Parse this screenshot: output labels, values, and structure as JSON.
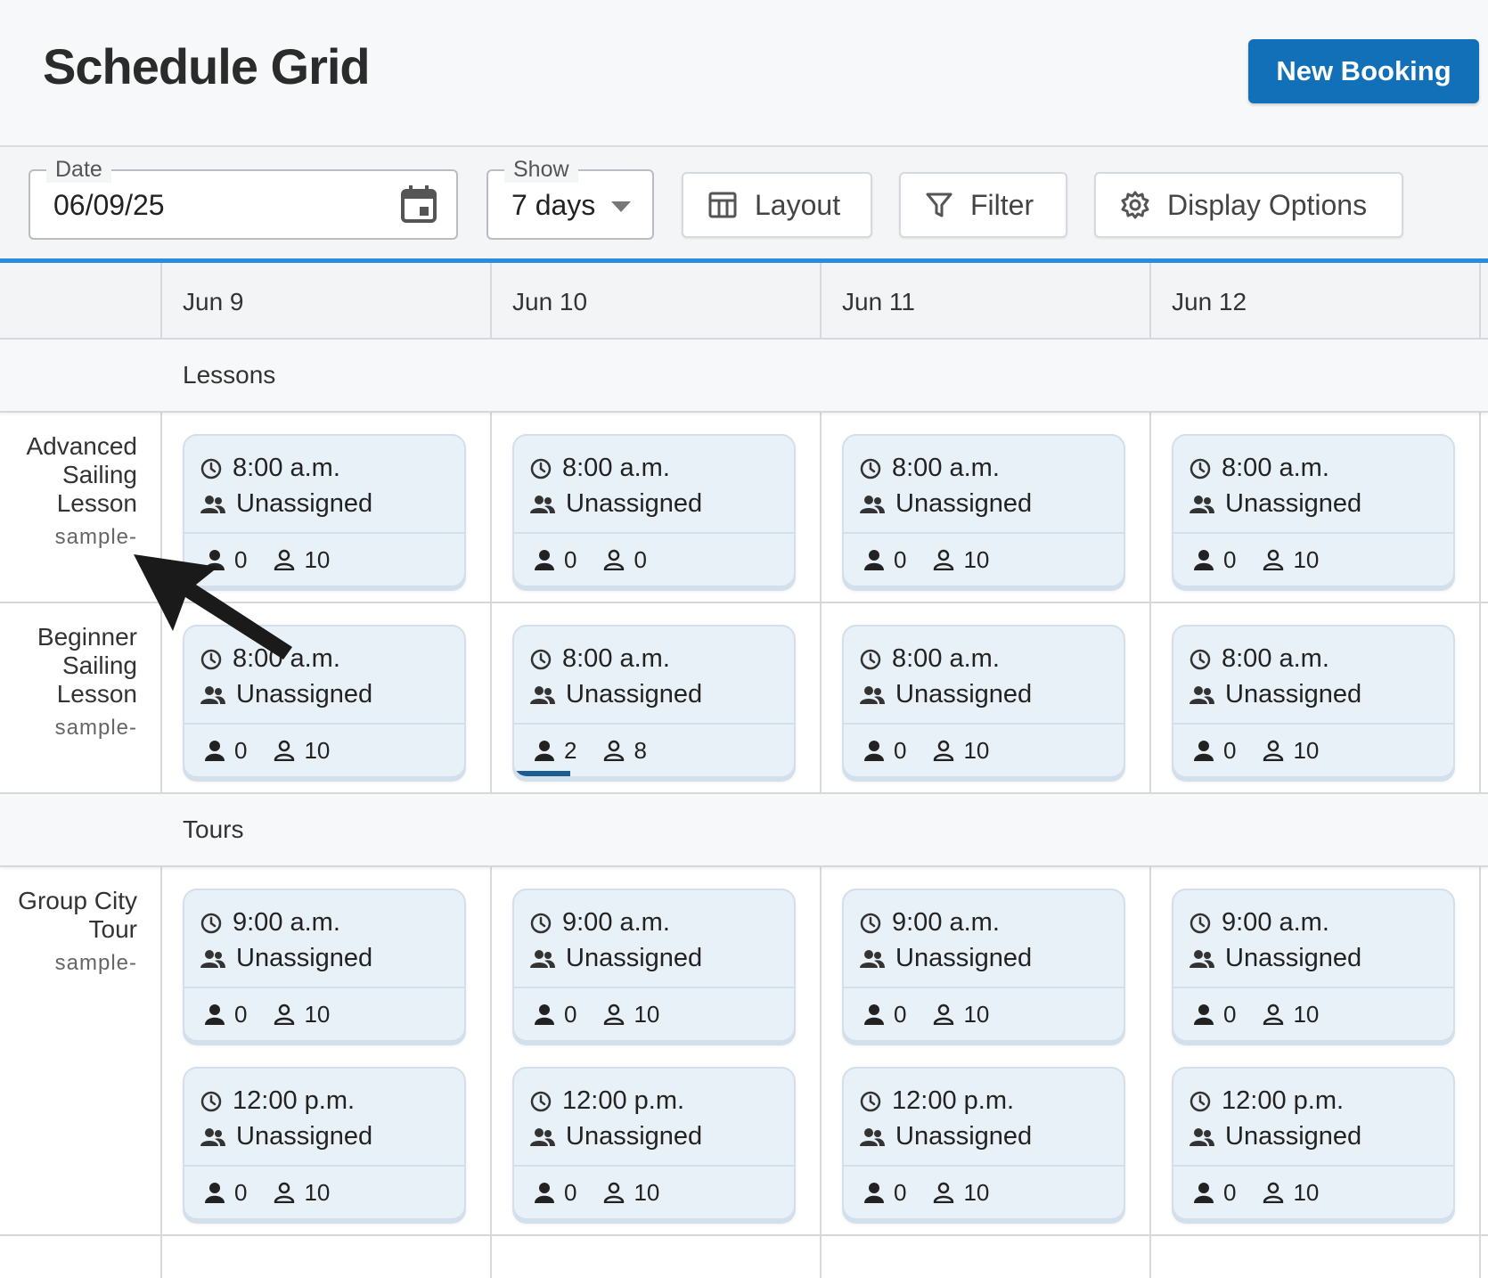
{
  "header": {
    "title": "Schedule Grid",
    "new_booking_label": "New Booking"
  },
  "toolbar": {
    "date": {
      "label": "Date",
      "value": "06/09/25",
      "icon": "calendar-icon"
    },
    "show": {
      "label": "Show",
      "value": "7 days",
      "icon": "caret-down-icon"
    },
    "layout_label": "Layout",
    "filter_label": "Filter",
    "display_label": "Display Options"
  },
  "accent_color": "#2a8be0",
  "primary_color": "#1270b8",
  "dates": [
    "Jun 9",
    "Jun 10",
    "Jun 11",
    "Jun 12"
  ],
  "sections": [
    {
      "name": "Lessons",
      "products": [
        {
          "name": "Advanced Sailing Lesson",
          "code": "sample-",
          "slots": [
            [
              {
                "time": "8:00 a.m.",
                "assignee": "Unassigned",
                "booked": "0",
                "available": "10",
                "fill": 0
              },
              {
                "time": "8:00 a.m.",
                "assignee": "Unassigned",
                "booked": "0",
                "available": "0",
                "fill": 0
              },
              {
                "time": "8:00 a.m.",
                "assignee": "Unassigned",
                "booked": "0",
                "available": "10",
                "fill": 0
              },
              {
                "time": "8:00 a.m.",
                "assignee": "Unassigned",
                "booked": "0",
                "available": "10",
                "fill": 0
              }
            ]
          ]
        },
        {
          "name": "Beginner Sailing Lesson",
          "code": "sample-",
          "slots": [
            [
              {
                "time": "8:00 a.m.",
                "assignee": "Unassigned",
                "booked": "0",
                "available": "10",
                "fill": 0
              },
              {
                "time": "8:00 a.m.",
                "assignee": "Unassigned",
                "booked": "2",
                "available": "8",
                "fill": 0.2
              },
              {
                "time": "8:00 a.m.",
                "assignee": "Unassigned",
                "booked": "0",
                "available": "10",
                "fill": 0
              },
              {
                "time": "8:00 a.m.",
                "assignee": "Unassigned",
                "booked": "0",
                "available": "10",
                "fill": 0
              }
            ]
          ]
        }
      ]
    },
    {
      "name": "Tours",
      "products": [
        {
          "name": "Group City Tour",
          "code": "sample-",
          "slots": [
            [
              {
                "time": "9:00 a.m.",
                "assignee": "Unassigned",
                "booked": "0",
                "available": "10",
                "fill": 0
              },
              {
                "time": "9:00 a.m.",
                "assignee": "Unassigned",
                "booked": "0",
                "available": "10",
                "fill": 0
              },
              {
                "time": "9:00 a.m.",
                "assignee": "Unassigned",
                "booked": "0",
                "available": "10",
                "fill": 0
              },
              {
                "time": "9:00 a.m.",
                "assignee": "Unassigned",
                "booked": "0",
                "available": "10",
                "fill": 0
              }
            ],
            [
              {
                "time": "12:00 p.m.",
                "assignee": "Unassigned",
                "booked": "0",
                "available": "10",
                "fill": 0
              },
              {
                "time": "12:00 p.m.",
                "assignee": "Unassigned",
                "booked": "0",
                "available": "10",
                "fill": 0
              },
              {
                "time": "12:00 p.m.",
                "assignee": "Unassigned",
                "booked": "0",
                "available": "10",
                "fill": 0
              },
              {
                "time": "12:00 p.m.",
                "assignee": "Unassigned",
                "booked": "0",
                "available": "10",
                "fill": 0
              }
            ]
          ]
        }
      ]
    }
  ]
}
